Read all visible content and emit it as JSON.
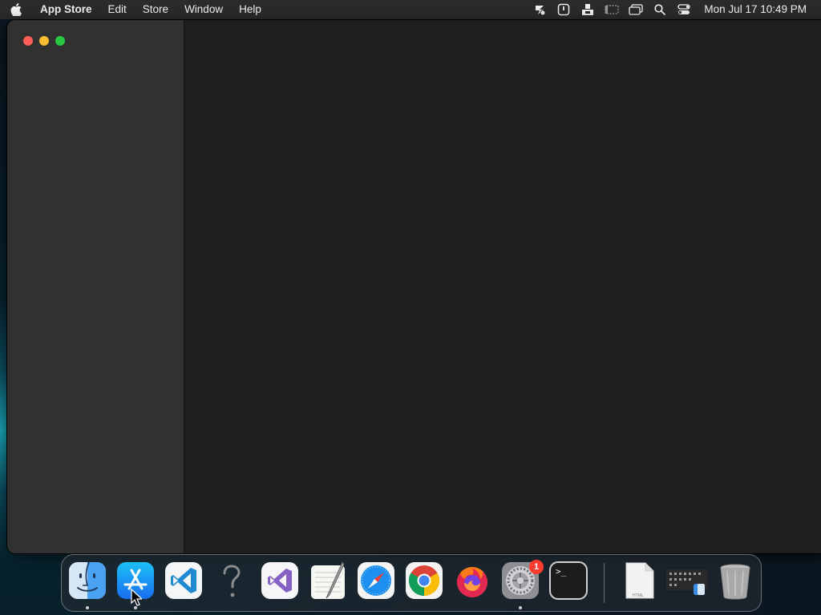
{
  "menubar": {
    "app_name": "App Store",
    "menus": [
      "Edit",
      "Store",
      "Window",
      "Help"
    ],
    "clock": "Mon Jul 17  10:49 PM"
  },
  "dock": {
    "apps": [
      {
        "name": "Finder",
        "icon": "finder-icon",
        "running": true
      },
      {
        "name": "App Store",
        "icon": "app-store-icon",
        "running": true
      },
      {
        "name": "Visual Studio Code",
        "icon": "vscode-icon",
        "running": false
      },
      {
        "name": "Unknown App",
        "icon": "question-mark-icon",
        "running": false
      },
      {
        "name": "Visual Studio",
        "icon": "visual-studio-icon",
        "running": false
      },
      {
        "name": "TextEdit",
        "icon": "textedit-icon",
        "running": false
      },
      {
        "name": "Safari",
        "icon": "safari-icon",
        "running": false
      },
      {
        "name": "Google Chrome",
        "icon": "chrome-icon",
        "running": false
      },
      {
        "name": "Firefox",
        "icon": "firefox-icon",
        "running": false
      },
      {
        "name": "System Settings",
        "icon": "system-settings-icon",
        "running": true
      },
      {
        "name": "Terminal",
        "icon": "terminal-icon",
        "running": false
      }
    ],
    "settings_badge": "1",
    "terminal_prompt": ">_",
    "html_file_label": "HTML"
  },
  "colors": {
    "close": "#ff5f57",
    "minimize": "#febc2e",
    "maximize": "#28c840"
  }
}
